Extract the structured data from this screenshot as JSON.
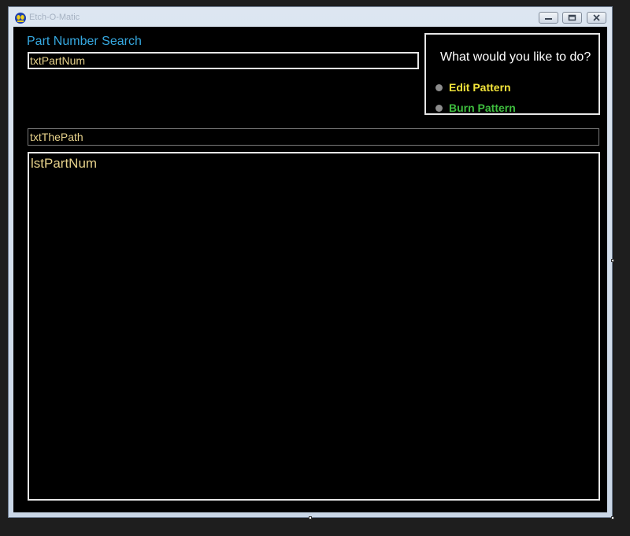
{
  "window": {
    "title": "Etch-O-Matic"
  },
  "icons": {
    "app": "app-icon",
    "minimize": "minimize-icon",
    "maximize": "maximize-icon",
    "close": "close-icon"
  },
  "form": {
    "search_label": "Part Number Search",
    "part_num_value": "txtPartNum",
    "action_group": {
      "question": "What would you like to do?",
      "options": [
        {
          "label": "Edit Pattern",
          "color": "#f2e33a"
        },
        {
          "label": "Burn Pattern",
          "color": "#3ebd3e"
        }
      ]
    },
    "path_value": "txtThePath",
    "list_label": "lstPartNum"
  },
  "colors": {
    "accent_blue": "#36a9e1",
    "field_text": "#e8d38c",
    "background": "#000000"
  }
}
